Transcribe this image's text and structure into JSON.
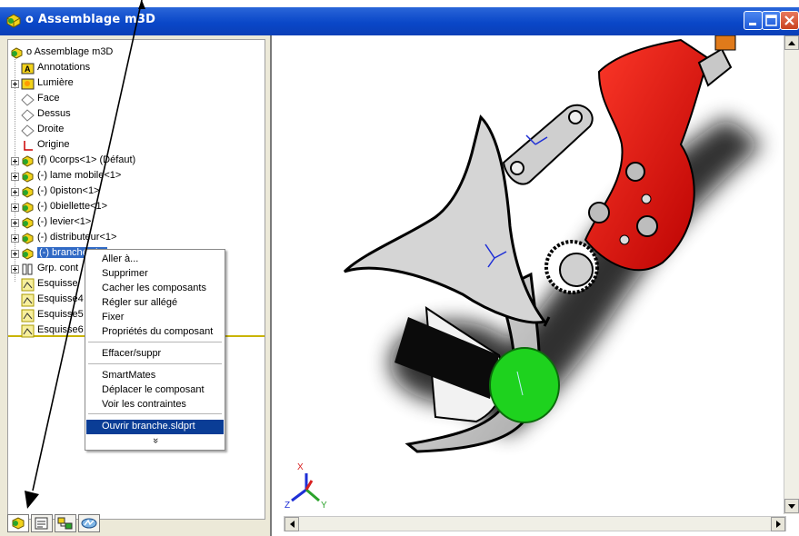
{
  "window": {
    "title": "o Assemblage m3D",
    "colors": {
      "titlebar": "#0a47c8",
      "selection": "#316ac5",
      "menu_highlight": "#0a3d96",
      "model_red": "#e01010",
      "model_green": "#1ed21e"
    }
  },
  "tree": {
    "items": [
      {
        "label": "o Assemblage m3D",
        "icon": "assembly-icon"
      },
      {
        "label": "Annotations",
        "icon": "annotations-icon"
      },
      {
        "label": "Lumière",
        "icon": "light-icon"
      },
      {
        "label": "Face",
        "icon": "plane-icon"
      },
      {
        "label": "Dessus",
        "icon": "plane-icon"
      },
      {
        "label": "Droite",
        "icon": "plane-icon"
      },
      {
        "label": "Origine",
        "icon": "origin-icon"
      },
      {
        "label": "(f) 0corps<1> (Défaut)",
        "icon": "part-icon"
      },
      {
        "label": "(-) lame mobile<1>",
        "icon": "part-icon"
      },
      {
        "label": "(-) 0piston<1>",
        "icon": "part-icon"
      },
      {
        "label": "(-) 0biellette<1>",
        "icon": "part-icon"
      },
      {
        "label": "(-) levier<1>",
        "icon": "part-icon"
      },
      {
        "label": "(-) distributeur<1>",
        "icon": "part-icon"
      },
      {
        "label": "(-) branche<1>",
        "icon": "part-icon"
      },
      {
        "label": "Grp. cont",
        "icon": "mates-icon"
      },
      {
        "label": "Esquisse",
        "icon": "sketch-icon"
      },
      {
        "label": "Esquisse4",
        "icon": "sketch-icon"
      },
      {
        "label": "Esquisse5",
        "icon": "sketch-icon"
      },
      {
        "label": "Esquisse6",
        "icon": "sketch-icon"
      }
    ]
  },
  "context_menu": {
    "items": [
      {
        "label": "Aller à..."
      },
      {
        "label": "Supprimer"
      },
      {
        "label": "Cacher les composants"
      },
      {
        "label": "Régler sur allégé"
      },
      {
        "label": "Fixer"
      },
      {
        "label": "Propriétés du composant"
      },
      {
        "label": "Effacer/suppr"
      },
      {
        "label": "SmartMates"
      },
      {
        "label": "Déplacer le composant"
      },
      {
        "label": "Voir les contraintes"
      },
      {
        "label": "Ouvrir branche.sldprt"
      }
    ],
    "more": "»"
  },
  "bottom_tabs": [
    {
      "name": "featuremanager-icon"
    },
    {
      "name": "propertymanager-icon"
    },
    {
      "name": "configurationmanager-icon"
    },
    {
      "name": "dimxpert-icon"
    }
  ],
  "triad_axes": {
    "x": "X",
    "y": "Y",
    "z": "Z"
  }
}
